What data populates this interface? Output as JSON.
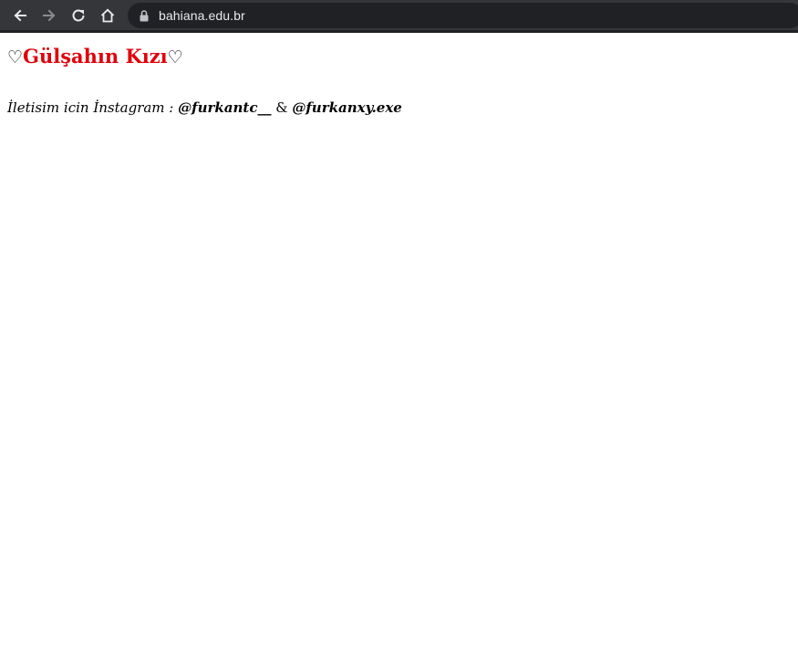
{
  "browser": {
    "url": "bahiana.edu.br",
    "icons": {
      "back": "back-arrow-icon",
      "forward": "forward-arrow-icon",
      "reload": "reload-icon",
      "home": "home-icon",
      "lock": "lock-icon"
    }
  },
  "page": {
    "heart_left": "♡",
    "title": "Gülşahın Kızı",
    "heart_right": "♡",
    "contact_prefix": "İletisim icin İnstagram : ",
    "handle_1": "@furkantc__",
    "separator": " & ",
    "handle_2": "@furkanxy.exe"
  },
  "colors": {
    "title": "#e0000c",
    "toolbar": "#35363a",
    "omnibox": "#202124"
  }
}
